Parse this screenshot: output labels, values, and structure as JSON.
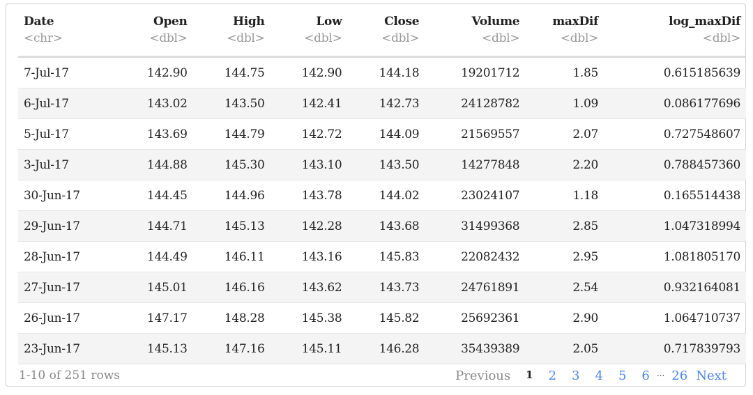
{
  "columns": [
    {
      "name": "Date",
      "type": "<chr>"
    },
    {
      "name": "Open",
      "type": "<dbl>"
    },
    {
      "name": "High",
      "type": "<dbl>"
    },
    {
      "name": "Low",
      "type": "<dbl>"
    },
    {
      "name": "Close",
      "type": "<dbl>"
    },
    {
      "name": "Volume",
      "type": "<dbl>"
    },
    {
      "name": "maxDif",
      "type": "<dbl>"
    },
    {
      "name": "log_maxDif",
      "type": "<dbl>"
    }
  ],
  "rows": [
    [
      "7-Jul-17",
      "142.90",
      "144.75",
      "142.90",
      "144.18",
      "19201712",
      "1.85",
      "0.615185639"
    ],
    [
      "6-Jul-17",
      "143.02",
      "143.50",
      "142.41",
      "142.73",
      "24128782",
      "1.09",
      "0.086177696"
    ],
    [
      "5-Jul-17",
      "143.69",
      "144.79",
      "142.72",
      "144.09",
      "21569557",
      "2.07",
      "0.727548607"
    ],
    [
      "3-Jul-17",
      "144.88",
      "145.30",
      "143.10",
      "143.50",
      "14277848",
      "2.20",
      "0.788457360"
    ],
    [
      "30-Jun-17",
      "144.45",
      "144.96",
      "143.78",
      "144.02",
      "23024107",
      "1.18",
      "0.165514438"
    ],
    [
      "29-Jun-17",
      "144.71",
      "145.13",
      "142.28",
      "143.68",
      "31499368",
      "2.85",
      "1.047318994"
    ],
    [
      "28-Jun-17",
      "144.49",
      "146.11",
      "143.16",
      "145.83",
      "22082432",
      "2.95",
      "1.081805170"
    ],
    [
      "27-Jun-17",
      "145.01",
      "146.16",
      "143.62",
      "143.73",
      "24761891",
      "2.54",
      "0.932164081"
    ],
    [
      "26-Jun-17",
      "147.17",
      "148.28",
      "145.38",
      "145.82",
      "25692361",
      "2.90",
      "1.064710737"
    ],
    [
      "23-Jun-17",
      "145.13",
      "147.16",
      "145.11",
      "146.28",
      "35439389",
      "2.05",
      "0.717839793"
    ]
  ],
  "footer": {
    "summary": "1-10 of 251 rows"
  },
  "pager": {
    "previous": "Previous",
    "pages": [
      "1",
      "2",
      "3",
      "4",
      "5",
      "6"
    ],
    "ellipsis": "...",
    "last": "26",
    "next": "Next",
    "current": "1"
  }
}
